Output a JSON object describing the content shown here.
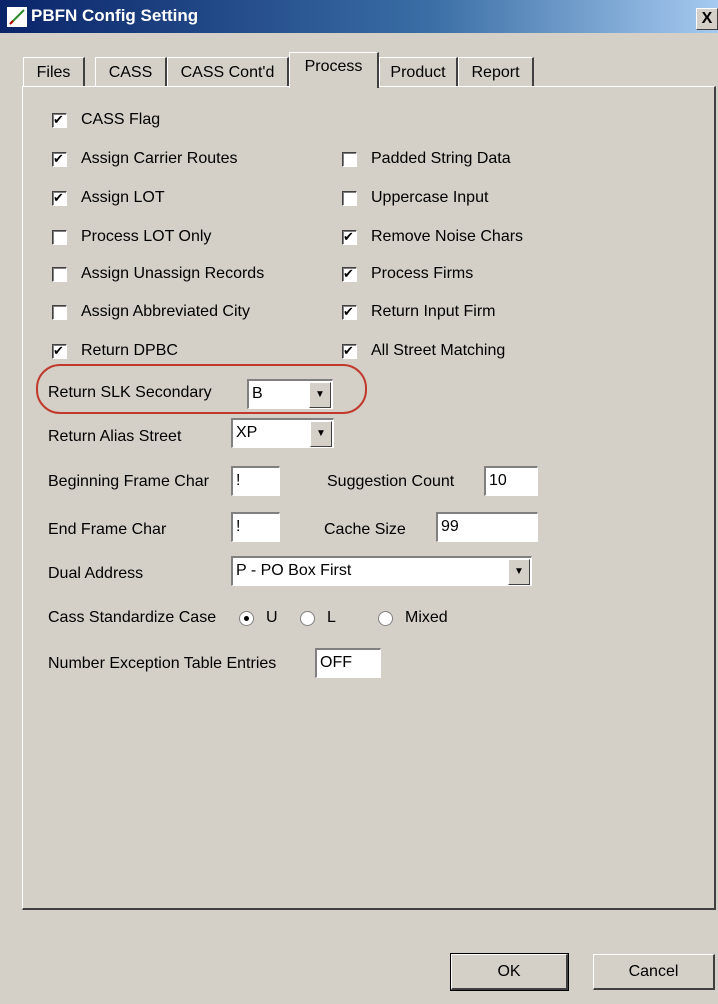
{
  "window": {
    "title": "PBFN Config Setting",
    "close_label": "X"
  },
  "tabs": [
    {
      "label": "Files"
    },
    {
      "label": "CASS"
    },
    {
      "label": "CASS Cont'd"
    },
    {
      "label": "Process",
      "active": true
    },
    {
      "label": "Product"
    },
    {
      "label": "Report"
    }
  ],
  "checkboxes_left": [
    {
      "label": "CASS Flag",
      "checked": true
    },
    {
      "label": "Assign Carrier Routes",
      "checked": true
    },
    {
      "label": "Assign LOT",
      "checked": true
    },
    {
      "label": "Process LOT Only",
      "checked": false
    },
    {
      "label": "Assign Unassign Records",
      "checked": false
    },
    {
      "label": "Assign Abbreviated City",
      "checked": false
    },
    {
      "label": "Return DPBC",
      "checked": true
    }
  ],
  "checkboxes_right": [
    {
      "label": "Padded String Data",
      "checked": false
    },
    {
      "label": "Uppercase Input",
      "checked": false
    },
    {
      "label": "Remove Noise Chars",
      "checked": true
    },
    {
      "label": "Process Firms",
      "checked": true
    },
    {
      "label": "Return Input Firm",
      "checked": true
    },
    {
      "label": "All Street Matching",
      "checked": true
    }
  ],
  "fields": {
    "return_slk_secondary": {
      "label": "Return SLK Secondary",
      "value": "B"
    },
    "return_alias_street": {
      "label": "Return Alias Street",
      "value": "XP"
    },
    "beginning_frame_char": {
      "label": "Beginning Frame Char",
      "value": "!"
    },
    "suggestion_count": {
      "label": "Suggestion Count",
      "value": "10"
    },
    "end_frame_char": {
      "label": "End Frame Char",
      "value": "!"
    },
    "cache_size": {
      "label": "Cache Size",
      "value": "99"
    },
    "dual_address": {
      "label": "Dual Address",
      "value": "P - PO Box First"
    },
    "number_exception": {
      "label": "Number Exception Table Entries",
      "value": "OFF"
    }
  },
  "standardize_case": {
    "label": "Cass Standardize Case",
    "options": [
      {
        "label": "U",
        "selected": true
      },
      {
        "label": "L",
        "selected": false
      },
      {
        "label": "Mixed",
        "selected": false
      }
    ]
  },
  "buttons": {
    "ok": "OK",
    "cancel": "Cancel"
  },
  "colors": {
    "titlebar": "#0a246a",
    "highlight_ring": "#c0392b",
    "face": "#d4d0c8"
  }
}
